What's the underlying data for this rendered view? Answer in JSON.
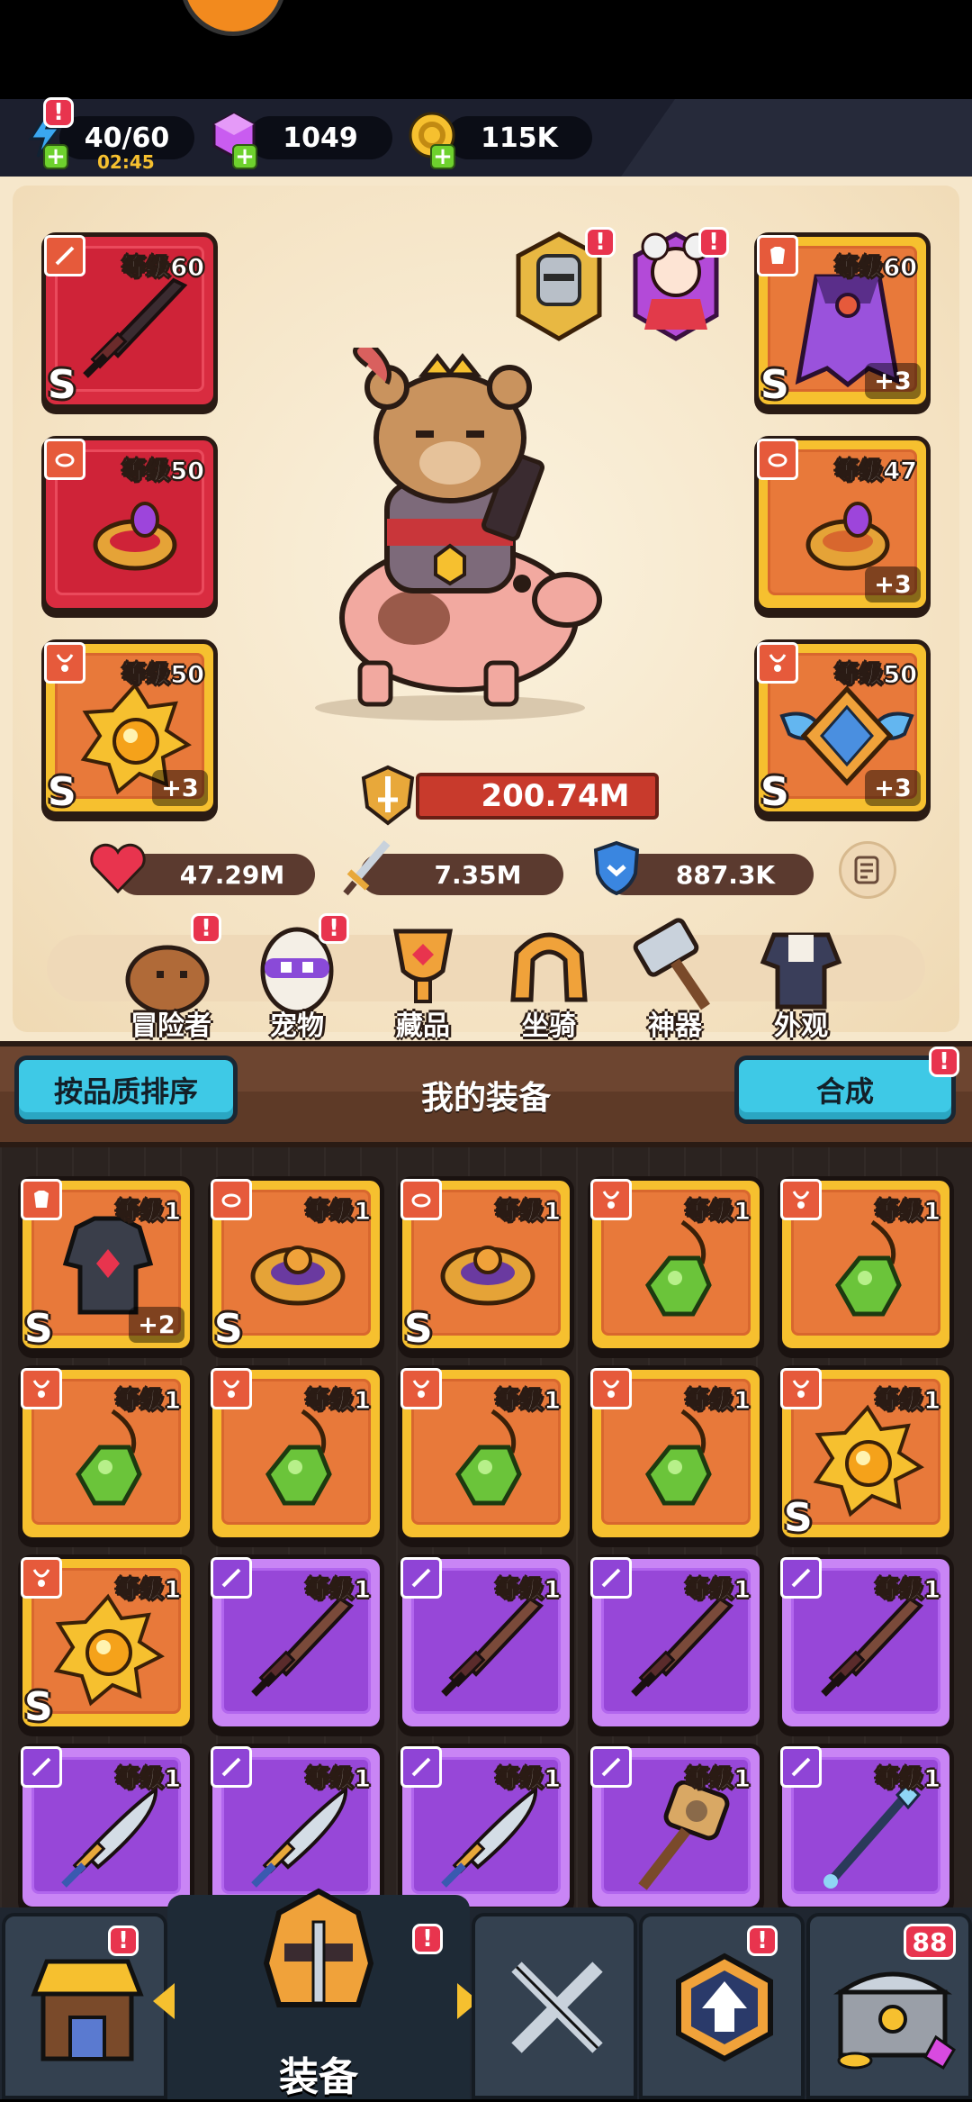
{
  "resources": {
    "energy": {
      "value": "40/60",
      "timer": "02:45"
    },
    "gems": {
      "value": "1049"
    },
    "gold": {
      "value": "115K"
    }
  },
  "equipped": {
    "weapon": {
      "level": "等级60",
      "rank": "S"
    },
    "ring_left": {
      "level": "等级50"
    },
    "amulet_left": {
      "level": "等级50",
      "rank": "S",
      "plus": "+3"
    },
    "cape": {
      "level": "等级60",
      "rank": "S",
      "plus": "+3"
    },
    "ring_right": {
      "level": "等级47",
      "plus": "+3"
    },
    "amulet_right": {
      "level": "等级50",
      "rank": "S",
      "plus": "+3"
    }
  },
  "power": "200.74M",
  "stats": {
    "hp": "47.29M",
    "attack": "7.35M",
    "defense": "887.3K"
  },
  "nav": [
    {
      "label": "冒险者",
      "badge": "!"
    },
    {
      "label": "宠物",
      "badge": "!"
    },
    {
      "label": "藏品"
    },
    {
      "label": "坐骑"
    },
    {
      "label": "神器"
    },
    {
      "label": "外观"
    }
  ],
  "list_header": {
    "sort_label": "按品质排序",
    "title": "我的装备",
    "merge_label": "合成",
    "merge_badge": "!"
  },
  "inventory": [
    {
      "level": "等级1",
      "rank": "S",
      "plus": "+2",
      "type": "armor",
      "quality": "orange"
    },
    {
      "level": "等级1",
      "rank": "S",
      "type": "ring",
      "quality": "orange"
    },
    {
      "level": "等级1",
      "rank": "S",
      "type": "ring",
      "quality": "orange"
    },
    {
      "level": "等级1",
      "type": "necklace",
      "quality": "orange"
    },
    {
      "level": "等级1",
      "type": "necklace",
      "quality": "orange"
    },
    {
      "level": "等级1",
      "type": "necklace",
      "quality": "orange"
    },
    {
      "level": "等级1",
      "type": "necklace",
      "quality": "orange"
    },
    {
      "level": "等级1",
      "type": "necklace",
      "quality": "orange"
    },
    {
      "level": "等级1",
      "type": "necklace",
      "quality": "orange"
    },
    {
      "level": "等级1",
      "rank": "S",
      "type": "sun-amulet",
      "quality": "orange"
    },
    {
      "level": "等级1",
      "rank": "S",
      "type": "sun-amulet",
      "quality": "orange"
    },
    {
      "level": "等级1",
      "type": "sword",
      "quality": "purple"
    },
    {
      "level": "等级1",
      "type": "sword",
      "quality": "purple"
    },
    {
      "level": "等级1",
      "type": "sword",
      "quality": "purple"
    },
    {
      "level": "等级1",
      "type": "sword",
      "quality": "purple"
    },
    {
      "level": "等级1",
      "type": "blade",
      "quality": "purple"
    },
    {
      "level": "等级1",
      "type": "blade",
      "quality": "purple"
    },
    {
      "level": "等级1",
      "type": "blade",
      "quality": "purple"
    },
    {
      "level": "等级1",
      "type": "hammer",
      "quality": "purple"
    },
    {
      "level": "等级1",
      "type": "staff",
      "quality": "purple"
    }
  ],
  "bottom_nav": {
    "active_label": "装备",
    "chest_count": "88"
  },
  "colors": {
    "quality_orange": "#f6c02f",
    "quality_purple": "#c985f5",
    "quality_red": "#d92c40",
    "accent_cyan": "#3ec9e6",
    "badge_red": "#e8344e"
  }
}
